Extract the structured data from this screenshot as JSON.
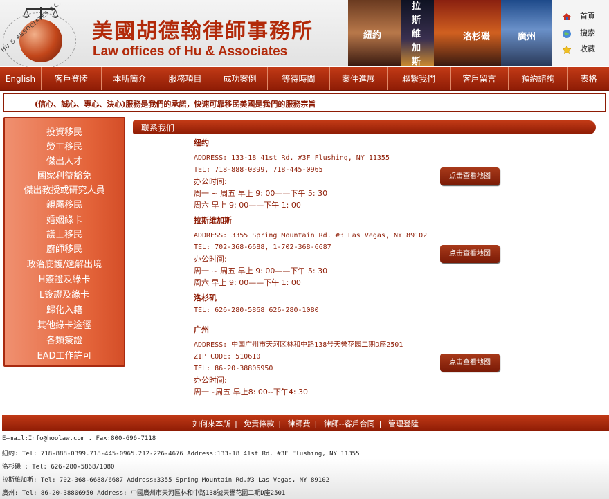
{
  "header": {
    "title_cn": "美國胡德翰律師事務所",
    "title_en": "Law offices of Hu & Associates",
    "logo_ring_text": "HU & ASSOCIATES P.C.",
    "cities": [
      "紐約",
      "拉斯維加斯",
      "洛杉磯",
      "廣州"
    ],
    "links": [
      {
        "label": "首頁",
        "icon": "home-icon"
      },
      {
        "label": "搜索",
        "icon": "globe-icon"
      },
      {
        "label": "收藏",
        "icon": "star-icon"
      }
    ]
  },
  "nav": [
    "English",
    "客戶登陸",
    "本所簡介",
    "服務項目",
    "成功案例",
    "等待時間",
    "案件進展",
    "聯繫我們",
    "客戶留言",
    "預約諮詢",
    "表格"
  ],
  "slogan": "(信心、誠心、專心、決心)服務是我們的承諾，快速可靠移民美國是我們的服務宗旨",
  "sidebar": [
    "投資移民",
    "勞工移民",
    "傑出人才",
    "國家利益豁免",
    "傑出教授或研究人員",
    "親屬移民",
    "婚姻綠卡",
    "護士移民",
    "廚師移民",
    "政治庇護/遞解出境",
    "H簽證及綠卡",
    "L簽證及綠卡",
    "歸化入籍",
    "其他綠卡途徑",
    "各類簽證",
    "EAD工作許可"
  ],
  "section_title": "联系我们",
  "map_button": "点击查看地图",
  "offices": {
    "ny": {
      "name": "纽约",
      "address": "ADDRESS: 133-18 41st Rd. #3F Flushing, NY 11355",
      "tel": "TEL: 718-888-0399, 718-445-0965",
      "hours_label": "办公时间:",
      "hours1": "周一 ~ 周五 早上 9: 00——下午 5: 30",
      "hours2": "周六 早上 9: 00——下午 1: 00"
    },
    "lv": {
      "name": "拉斯维加斯",
      "address": "ADDRESS: 3355 Spring Mountain Rd. #3 Las Vegas, NY 89102",
      "tel": "TEL: 702-368-6688, 1-702-368-6687",
      "hours_label": "办公时间:",
      "hours1": "周一 ~ 周五 早上 9: 00——下午 5: 30",
      "hours2": "周六 早上 9: 00——下午 1: 00"
    },
    "la": {
      "name": "洛杉矶",
      "tel": "TEL: 626-280-5868 626-280-1080"
    },
    "gz": {
      "name": "广州",
      "address": "ADDRESS: 中国广州市天河区林和中路138号天誉花园二期D座2501",
      "zip": "ZIP CODE: 510610",
      "tel": "TEL:  86-20-38806950",
      "hours_label": "办公时间:",
      "hours1": "周一~周五 早上8: 00--下午4: 30"
    }
  },
  "footer": {
    "links": [
      "如何來本所",
      "免責條款",
      "律師費",
      "律師--客戶合同",
      "管理登陸"
    ],
    "email": "E—mail:Info@hoolaw.com . Fax:800-696-7118",
    "ny": "紐約: Tel: 718-888-0399.718-445-0965.212-226-4676 Address:133-18 41st Rd. #3F Flushing, NY 11355",
    "la": "洛杉磯 : Tel: 626-280-5868/1080",
    "lv": "拉斯維加斯: Tel: 702-368-6688/6687 Address:3355 Spring Mountain Rd.#3 Las Vegas, NY 89102",
    "gz": "廣州: Tel: 86-20-38806950 Address: 中國廣州市天河區林和中路138號天譽花園二期D座2501"
  },
  "colors": {
    "brand": "#8e1c05",
    "accent": "#c23a16"
  }
}
